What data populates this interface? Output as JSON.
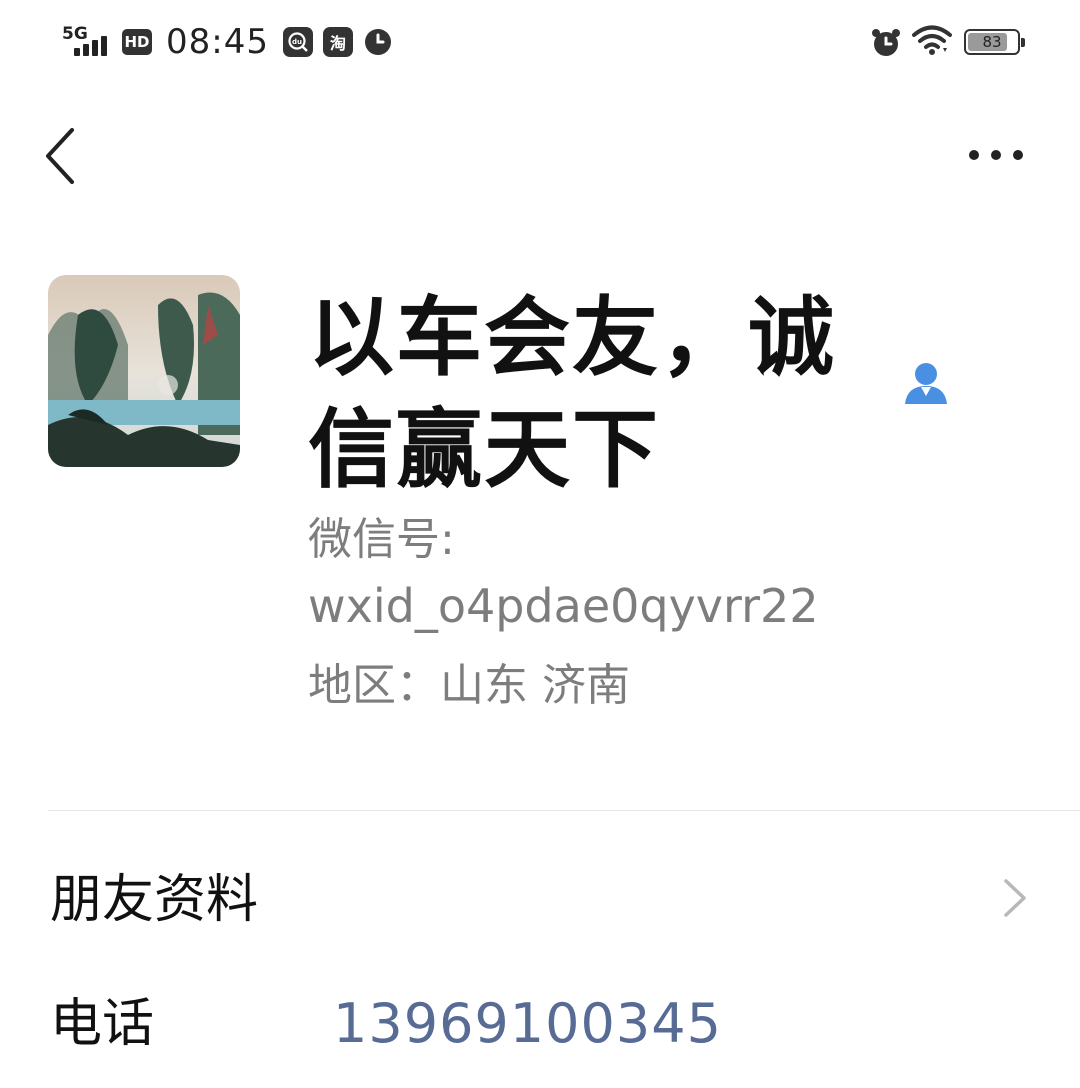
{
  "status_bar": {
    "network": "5G",
    "hd_badge": "HD",
    "time": "08:45",
    "app_icons": [
      "du-icon",
      "taobao-icon",
      "clock-icon"
    ],
    "taobao_glyph": "淘",
    "du_glyph": "du",
    "battery_level": "83"
  },
  "profile": {
    "name": "以车会友，诚信赢天下",
    "wechat_id_label": "微信号:",
    "wechat_id": "wxid_o4pdae0qyvrr22",
    "region": "地区：山东  济南"
  },
  "rows": {
    "friend_info_label": "朋友资料",
    "phone_label": "电话",
    "phone_value": "13969100345"
  },
  "colors": {
    "link": "#576b95",
    "secondary_text": "#7d7d7d",
    "contact_icon": "#4a90e2"
  }
}
